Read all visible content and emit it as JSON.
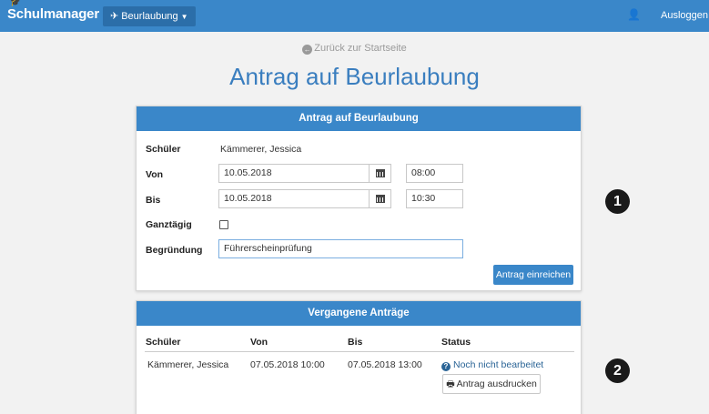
{
  "navbar": {
    "brand": "Schulmanager",
    "brand_icon": "graduation-cap-icon",
    "menu_label": "Beurlaubung",
    "menu_icon": "person-walking-icon",
    "user_icon": "user-icon",
    "logout_label": "Ausloggen",
    "color": "#3a87c9"
  },
  "page": {
    "back_link": "Zurück zur Startseite",
    "title": "Antrag auf Beurlaubung",
    "title_color": "#3a7ebf"
  },
  "form_panel": {
    "heading": "Antrag auf Beurlaubung",
    "student_label": "Schüler",
    "student_value": "Kämmerer, Jessica",
    "from_label": "Von",
    "from_date": "10.05.2018",
    "from_time": "08:00",
    "to_label": "Bis",
    "to_date": "10.05.2018",
    "to_time": "10:30",
    "allday_label": "Ganztägig",
    "allday_checked": false,
    "reason_label": "Begründung",
    "reason_value": "Führerscheinprüfung",
    "submit_label": "Antrag einreichen"
  },
  "history_panel": {
    "heading": "Vergangene Anträge",
    "columns": [
      "Schüler",
      "Von",
      "Bis",
      "Status"
    ],
    "rows": [
      {
        "student": "Kämmerer, Jessica",
        "from": "07.05.2018 10:00",
        "to": "07.05.2018 13:00",
        "status": "Noch nicht bearbeitet",
        "print_label": "Antrag ausdrucken"
      }
    ]
  },
  "callouts": [
    "1",
    "2"
  ]
}
